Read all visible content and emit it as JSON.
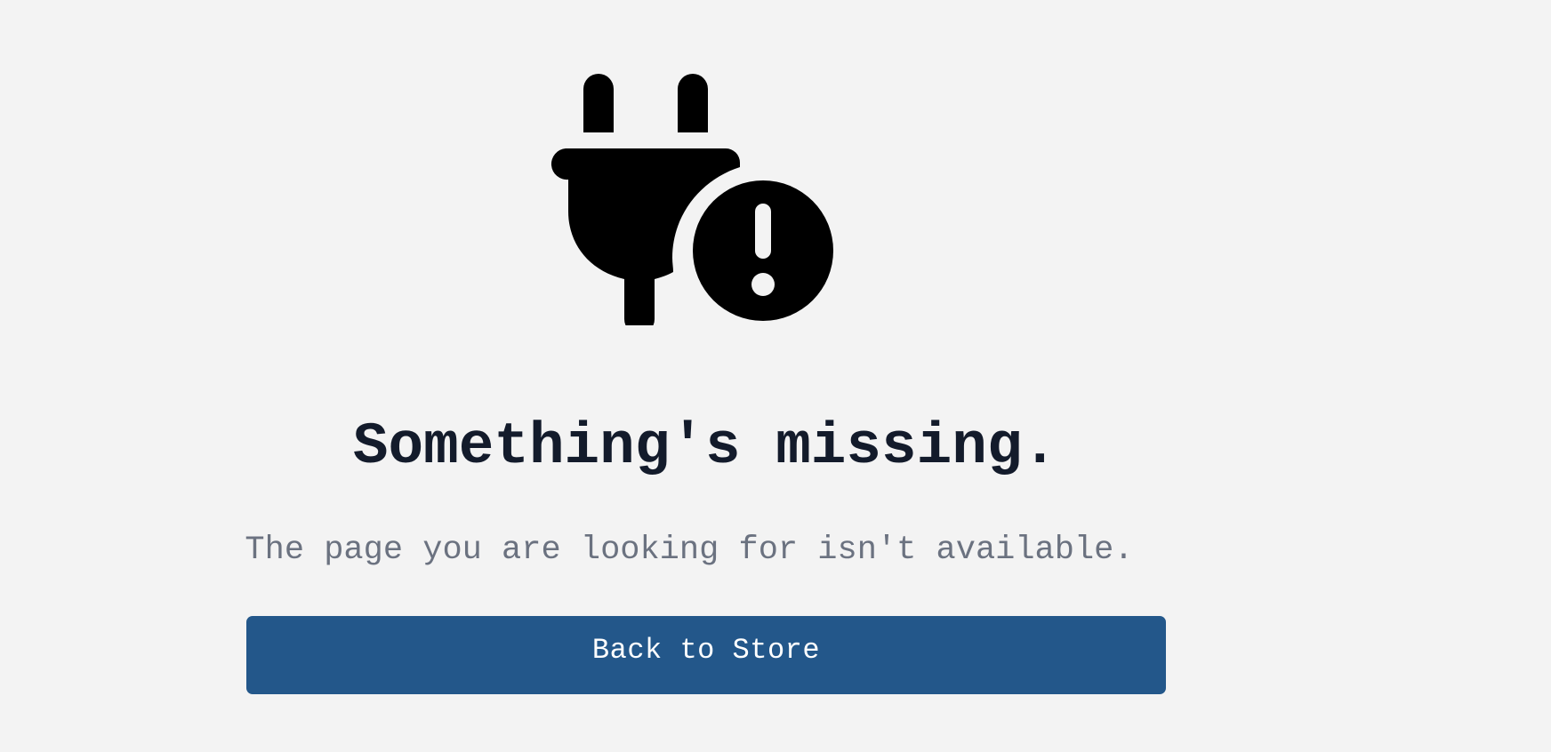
{
  "illustration": {
    "icon": "unplugged-plug-with-exclamation-icon",
    "color": "#000000"
  },
  "headline": "Something's missing.",
  "subtext": "The page you are looking for isn't available.",
  "back_button": {
    "label": "Back to Store",
    "color": "#23578a",
    "text_color": "#ffffff"
  },
  "colors": {
    "background": "#f3f3f3",
    "headline": "#131b2b",
    "subtext": "#6b7280"
  }
}
